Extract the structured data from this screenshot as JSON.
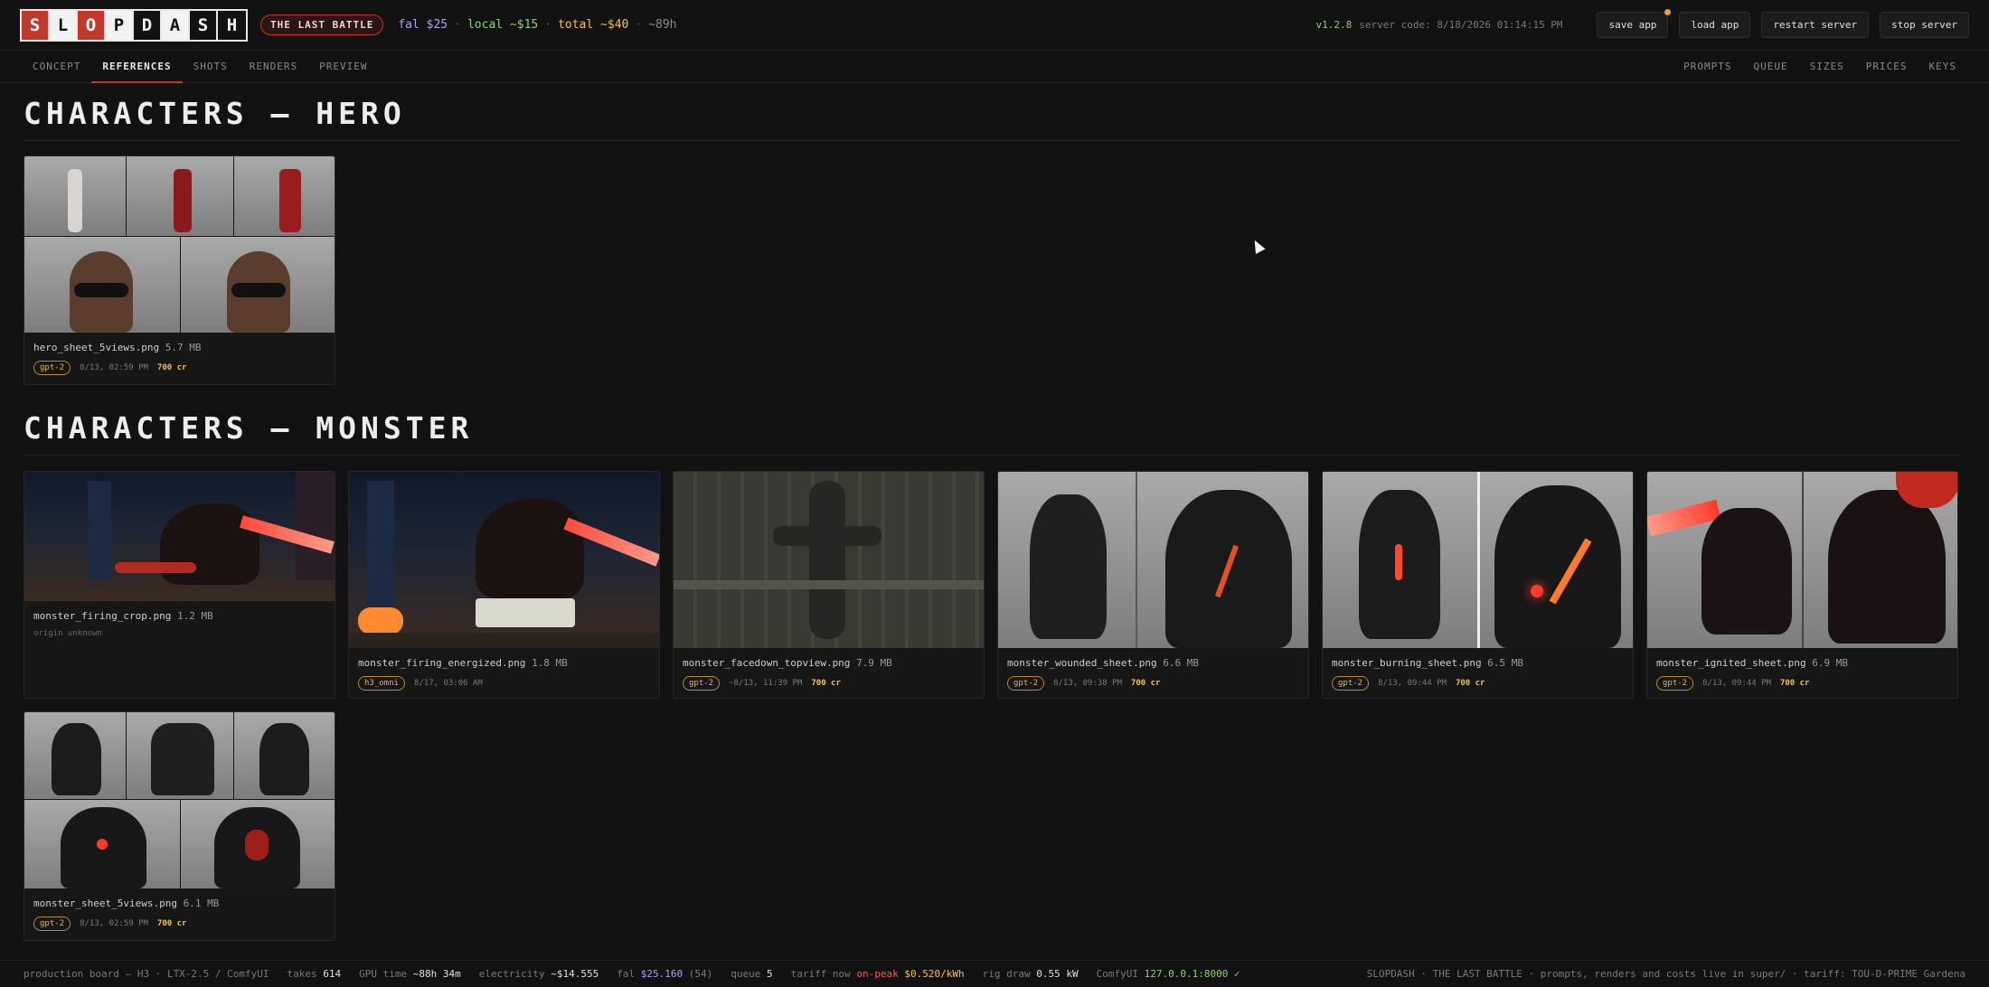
{
  "app": {
    "logo_letters": [
      "S",
      "L",
      "O",
      "P",
      "D",
      "A",
      "S",
      "H"
    ],
    "project": "THE LAST BATTLE",
    "costs": {
      "fal": "fal $25",
      "local": "local ~$15",
      "total": "total ~$40",
      "hours": "~89h",
      "sep": "·"
    },
    "version": "v1.2.8",
    "server_code": "server code: 8/18/2026 01:14:15 PM",
    "buttons": {
      "save": "save app",
      "load": "load app",
      "restart": "restart server",
      "stop": "stop server"
    },
    "colors": {
      "accent": "#c0392b",
      "fal": "#b79bff",
      "local": "#8fd17a",
      "total": "#f0c060"
    }
  },
  "nav": {
    "left": [
      "CONCEPT",
      "REFERENCES",
      "SHOTS",
      "RENDERS",
      "PREVIEW"
    ],
    "right": [
      "PROMPTS",
      "QUEUE",
      "SIZES",
      "PRICES",
      "KEYS"
    ],
    "active": "REFERENCES"
  },
  "sections": {
    "hero": {
      "title": "CHARACTERS — HERO",
      "cards": [
        {
          "name": "hero_sheet_5views.png",
          "size": "5.7 MB",
          "model": "gpt-2",
          "time": "8/13, 02:59 PM",
          "credits": "700 cr"
        }
      ]
    },
    "monster": {
      "title": "CHARACTERS — MONSTER",
      "cards": [
        {
          "name": "monster_firing_crop.png",
          "size": "1.2 MB",
          "origin": "origin unknown"
        },
        {
          "name": "monster_firing_energized.png",
          "size": "1.8 MB",
          "model": "h3_omni",
          "time": "8/17, 03:06 AM"
        },
        {
          "name": "monster_facedown_topview.png",
          "size": "7.9 MB",
          "model": "gpt-2",
          "time": "~8/13, 11:39 PM",
          "credits": "700 cr"
        },
        {
          "name": "monster_wounded_sheet.png",
          "size": "6.6 MB",
          "model": "gpt-2",
          "time": "8/13, 09:38 PM",
          "credits": "700 cr"
        },
        {
          "name": "monster_burning_sheet.png",
          "size": "6.5 MB",
          "model": "gpt-2",
          "time": "8/13, 09:44 PM",
          "credits": "700 cr"
        },
        {
          "name": "monster_ignited_sheet.png",
          "size": "6.9 MB",
          "model": "gpt-2",
          "time": "8/13, 09:44 PM",
          "credits": "700 cr"
        },
        {
          "name": "monster_sheet_5views.png",
          "size": "6.1 MB",
          "model": "gpt-2",
          "time": "8/13, 02:59 PM",
          "credits": "700 cr"
        }
      ]
    }
  },
  "footer": {
    "board": "production board — H3 · LTX-2.5 / ComfyUI",
    "takes_label": "takes",
    "takes": "614",
    "gpu_label": "GPU time",
    "gpu": "~88h 34m",
    "elec_label": "electricity",
    "elec": "~$14.555",
    "fal_label": "fal",
    "fal": "$25.160",
    "fal_count": "(54)",
    "queue_label": "queue",
    "queue": "5",
    "tariff_label": "tariff now",
    "tariff": "on-peak",
    "tariff_price": "$0.520/kWh",
    "rig_label": "rig draw",
    "rig": "0.55 kW",
    "comfy_label": "ComfyUI",
    "comfy": "127.0.0.1:8000 ✓",
    "right": "SLOPDASH · THE LAST BATTLE · prompts, renders and costs live in super/ · tariff: TOU-D-PRIME Gardena"
  }
}
